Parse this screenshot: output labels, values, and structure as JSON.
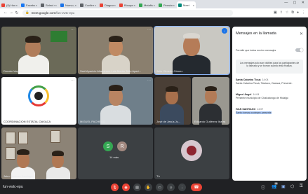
{
  "browser": {
    "tabs": [
      {
        "label": "(9) Hom",
        "color": "#ea4335"
      },
      {
        "label": "Facebook",
        "color": "#1877f2"
      },
      {
        "label": "Select sc",
        "color": "#5f6368"
      },
      {
        "label": "Nuevo pr",
        "color": "#1a73e8"
      },
      {
        "label": "Confirma",
        "color": "#5f6368"
      },
      {
        "label": "Diagrama",
        "color": "#ea4335"
      },
      {
        "label": "Búsqued",
        "color": "#ea4335"
      },
      {
        "label": "Metafisic",
        "color": "#34a853"
      },
      {
        "label": "Pension",
        "color": "#34a853"
      },
      {
        "label": "Meet",
        "color": "#00897b",
        "active": true
      }
    ],
    "url_host": "meet.google.com",
    "url_path": "/fun-vwtc-epu"
  },
  "participants": [
    {
      "name": "Donato Vargas",
      "speaking": false
    },
    {
      "name": "Saúl Aparicio Altamirano  Luis Martín Tello Apari...",
      "speaking": false
    },
    {
      "name": "Julio Olmedo Gómez",
      "speaking": true
    },
    {
      "name": "COORDINACION ESTATAL OAXACA",
      "speaking": false
    },
    {
      "name": "MIGUEL PACHECO",
      "speaking": false
    },
    {
      "name": "José de Jesús Ju...",
      "speaking": false
    },
    {
      "name": "Eduardo Gutiérrez Ibarra",
      "speaking": false
    },
    {
      "name": "Jairo Jiménez Santiago",
      "speaking": false
    },
    {
      "name": "14 más",
      "speaking": false,
      "avatars": [
        "S",
        "R"
      ]
    },
    {
      "name": "Tú",
      "speaking": false
    }
  ],
  "chat": {
    "title": "Mensajes en la llamada",
    "toggle_label": "Permitir que todos envíen mensajes",
    "notice": "Los mensajes solo son visibles para los participantes de la llamada y se borran cuando ésta finaliza.",
    "messages": [
      {
        "sender": "Santa Catarina Tlcuá",
        "time": "14:04",
        "text": "Santa Catarina Ticuá, Tlaxiaco, Oaxaca, Presente."
      },
      {
        "sender": "Miguel Ángel",
        "time": "14:04",
        "text": "Presente municipio de Chalcatongo de Hidalgo"
      },
      {
        "sender": "IVAN SANTIAGO",
        "time": "14:07",
        "text": "Santo tomas ocotepec presente"
      }
    ],
    "input_placeholder": "Envía un mensaje a todos"
  },
  "bottom": {
    "meeting_code": "fun-vwtc-epu",
    "participant_count": "28"
  }
}
